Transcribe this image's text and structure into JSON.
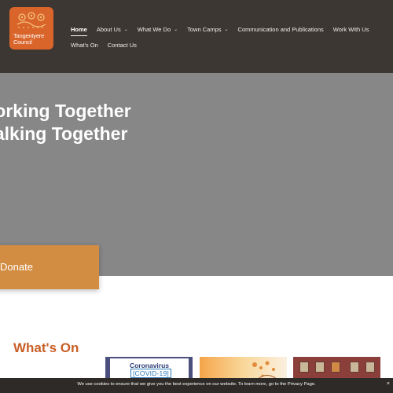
{
  "logo": {
    "line1": "Tangentyere",
    "line2": "Council",
    "color": "#d9652b"
  },
  "nav": {
    "row1": [
      {
        "label": "Home",
        "active": true,
        "dropdown": false
      },
      {
        "label": "About Us",
        "dropdown": true
      },
      {
        "label": "What We Do",
        "dropdown": true
      },
      {
        "label": "Town Camps",
        "dropdown": true
      },
      {
        "label": "Communication and Publications",
        "dropdown": false
      },
      {
        "label": "Work With Us",
        "dropdown": false
      }
    ],
    "row2": [
      {
        "label": "What's On",
        "dropdown": false
      },
      {
        "label": "Contact Us",
        "dropdown": false
      }
    ],
    "chevron": "⌄"
  },
  "hero": {
    "line1": "Working Together",
    "line2": "Walking Together",
    "donate_label": "Donate"
  },
  "whats_on": {
    "heading": "What's On",
    "cards": [
      {
        "title": "Coronavirus",
        "subtitle": "[COVID-19]"
      },
      {},
      {}
    ]
  },
  "cookie": {
    "text": "We use cookies to ensure that we give you the best experience on our website. To learn more, go to the Privacy Page.",
    "close": "×"
  },
  "colors": {
    "header_bg": "#3d3733",
    "hero_bg": "#878787",
    "accent": "#c95f27",
    "donate": "#d38d42"
  }
}
